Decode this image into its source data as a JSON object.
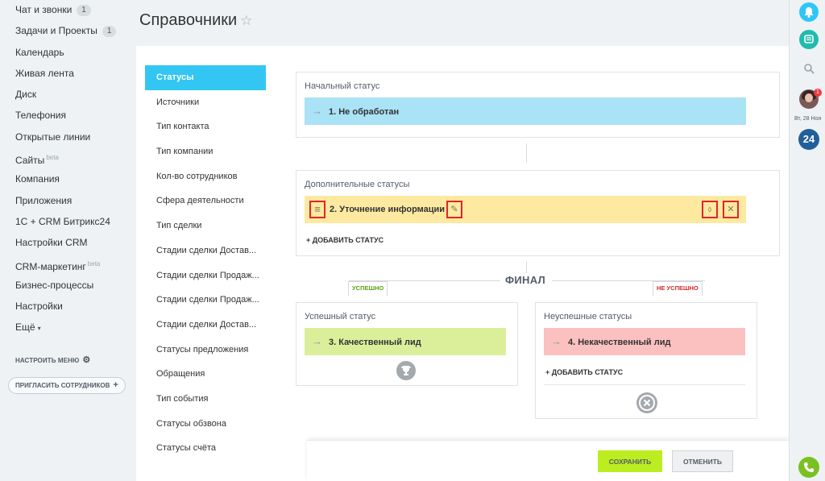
{
  "sidebar": {
    "items": [
      {
        "label": "Чат и звонки",
        "badge": "1"
      },
      {
        "label": "Задачи и Проекты",
        "badge": "1"
      },
      {
        "label": "Календарь"
      },
      {
        "label": "Живая лента"
      },
      {
        "label": "Диск"
      },
      {
        "label": "Телефония"
      },
      {
        "label": "Открытые линии"
      },
      {
        "label": "Сайты",
        "sup": "beta"
      },
      {
        "label": "Компания"
      },
      {
        "label": "Приложения"
      },
      {
        "label": "1С + CRM Битрикс24"
      },
      {
        "label": "Настройки CRM"
      },
      {
        "label": "CRM-маркетинг",
        "sup": "beta"
      },
      {
        "label": "Бизнес-процессы"
      },
      {
        "label": "Настройки"
      },
      {
        "label": "Ещё",
        "caret": "▾"
      }
    ],
    "setup_menu": "НАСТРОИТЬ МЕНЮ",
    "invite": "ПРИГЛАСИТЬ СОТРУДНИКОВ"
  },
  "header": {
    "title": "Справочники"
  },
  "tabs": [
    "Статусы",
    "Источники",
    "Тип контакта",
    "Тип компании",
    "Кол-во сотрудников",
    "Сфера деятельности",
    "Тип сделки",
    "Стадии сделки Достав...",
    "Стадии сделки Продаж...",
    "Стадии сделки Продаж...",
    "Стадии сделки Достав...",
    "Статусы предложения",
    "Обращения",
    "Тип события",
    "Статусы обзвона",
    "Статусы счёта"
  ],
  "initial": {
    "title": "Начальный статус",
    "status": "1. Не обработан"
  },
  "additional": {
    "title": "Дополнительные статусы",
    "status": "2. Уточнение информации",
    "add_label": "+ ДОБАВИТЬ СТАТУС"
  },
  "final": {
    "label": "ФИНАЛ",
    "success_tag": "УСПЕШНО",
    "fail_tag": "НЕ УСПЕШНО",
    "success": {
      "title": "Успешный статус",
      "status": "3. Качественный лид"
    },
    "fail": {
      "title": "Неуспешные статусы",
      "status": "4. Некачественный лид",
      "add_label": "+ ДОБАВИТЬ СТАТУС"
    }
  },
  "footer": {
    "save": "СОХРАНИТЬ",
    "cancel": "ОТМЕНИТЬ"
  },
  "rightbar": {
    "notif_count": "1",
    "date": "Вт, 28 Ноя",
    "logo": "24"
  },
  "colors": {
    "accent": "#33c6f2",
    "initial_row": "#aae2f6",
    "additional_row": "#fdeaa0",
    "success_row": "#dbef9a",
    "fail_row": "#fbc0c0",
    "save_button": "#bbed21"
  },
  "icons": {
    "arrow": "→",
    "drag": "≡",
    "edit": "✎",
    "color": "⬨",
    "delete": "✕",
    "trophy": "🏆",
    "fail_icon": "⊗",
    "star": "☆",
    "gear": "⚙",
    "plus": "+",
    "bell": "🔔",
    "chat": "▣",
    "search": "⌕",
    "phone": "✆"
  }
}
